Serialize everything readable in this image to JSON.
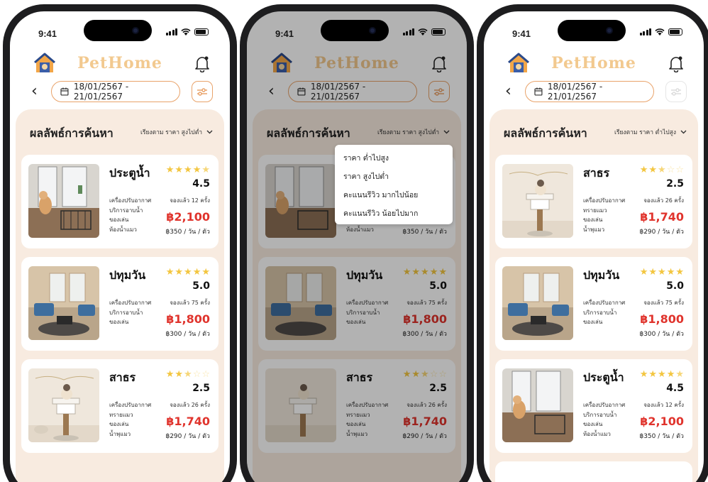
{
  "status": {
    "time": "9:41"
  },
  "header": {
    "brand": "PetHome"
  },
  "search": {
    "date_range": "18/01/2567 - 21/01/2567"
  },
  "results": {
    "title": "ผลลัพธ์การค้นหา",
    "sort_high_low": "เรียงตาม ราคา สูงไปต่ำ",
    "sort_low_high": "เรียงตาม ราคา ต่ำไปสูง"
  },
  "sort_menu": [
    "ราคา ต่ำไปสูง",
    "ราคา สูงไปต่ำ",
    "คะแนนรีวิว มากไปน้อย",
    "คะแนนรีวิว น้อยไปมาก"
  ],
  "hotels": {
    "pratunam": {
      "name": "ประตูน้ำ",
      "rating": "4.5",
      "stars": 4.5,
      "amenities": [
        "เครื่องปรับอากาศ",
        "บริการอาบน้ำ",
        "ของเล่น",
        "ห้องน้ำแมว"
      ],
      "booked": "จองแล้ว 12 ครั้ง",
      "price": "฿2,100",
      "per_day": "฿350 / วัน / ตัว"
    },
    "pathumwan": {
      "name": "ปทุมวัน",
      "rating": "5.0",
      "stars": 5,
      "amenities": [
        "เครื่องปรับอากาศ",
        "บริการอาบน้ำ",
        "ของเล่น"
      ],
      "booked": "จองแล้ว 75 ครั้ง",
      "price": "฿1,800",
      "per_day": "฿300 / วัน / ตัว"
    },
    "sathorn": {
      "name": "สาธร",
      "rating": "2.5",
      "stars": 2.5,
      "amenities": [
        "เครื่องปรับอากาศ",
        "ทรายแมว",
        "ของเล่น",
        "น้ำพุแมว"
      ],
      "booked": "จองแล้ว 26 ครั้ง",
      "price": "฿1,740",
      "per_day": "฿290 / วัน / ตัว"
    }
  },
  "icons": {
    "house": "house-logo-icon",
    "bell": "bell-icon",
    "back": "chevron-left-icon",
    "calendar": "calendar-icon",
    "filter": "filter-sliders-icon",
    "sort": "chevron-down-icon"
  },
  "colors": {
    "brand": "#f2c98f",
    "accent_border": "#e9a36a",
    "price": "#e0342d",
    "sheet": "#f8ebe0",
    "star": "#f3c640"
  }
}
